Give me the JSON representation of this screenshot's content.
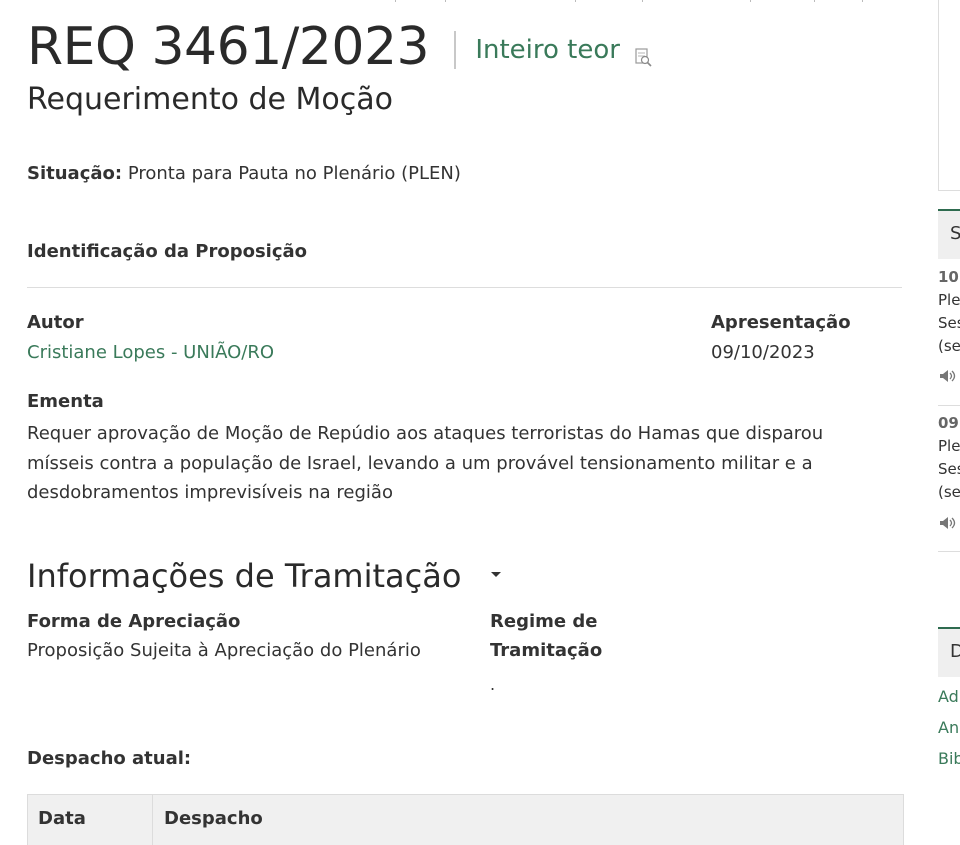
{
  "header": {
    "number": "REQ 3461/2023",
    "full_text_link": "Inteiro teor",
    "type": "Requerimento de Moção"
  },
  "situacao": {
    "label": "Situação:",
    "value": "Pronta para Pauta no Plenário (PLEN)"
  },
  "identificacao": {
    "heading": "Identificação da Proposição",
    "author_label": "Autor",
    "author_value": "Cristiane Lopes - UNIÃO/RO",
    "presentation_label": "Apresentação",
    "presentation_value": "09/10/2023",
    "ementa_label": "Ementa",
    "ementa_value": "Requer aprovação de Moção de Repúdio aos ataques terroristas do Hamas que disparou mísseis contra a população de Israel, levando a um provável tensionamento militar e a desdobramentos imprevisíveis na região"
  },
  "tramitacao": {
    "heading": "Informações de Tramitação",
    "forma_label": "Forma de Apreciação",
    "forma_value": "Proposição Sujeita à Apreciação do Plenário",
    "regime_label_1": "Regime de",
    "regime_label_2": "Tramitação",
    "regime_value": "."
  },
  "despacho": {
    "heading": "Despacho atual:",
    "columns": [
      "Data",
      "Despacho"
    ]
  },
  "sidebar": {
    "tab1": "S",
    "items": [
      {
        "date": "10.",
        "line1": "Ple",
        "line2": "Ses",
        "line3": "(se"
      },
      {
        "date": "09.",
        "line1": "Ple",
        "line2": "Ses",
        "line3": "(se"
      }
    ],
    "tab2": "D",
    "links": [
      "Ad",
      "An",
      "Bib"
    ]
  },
  "colors": {
    "accent_green": "#3a7a5a",
    "sidebar_border": "#2e6b4f"
  }
}
